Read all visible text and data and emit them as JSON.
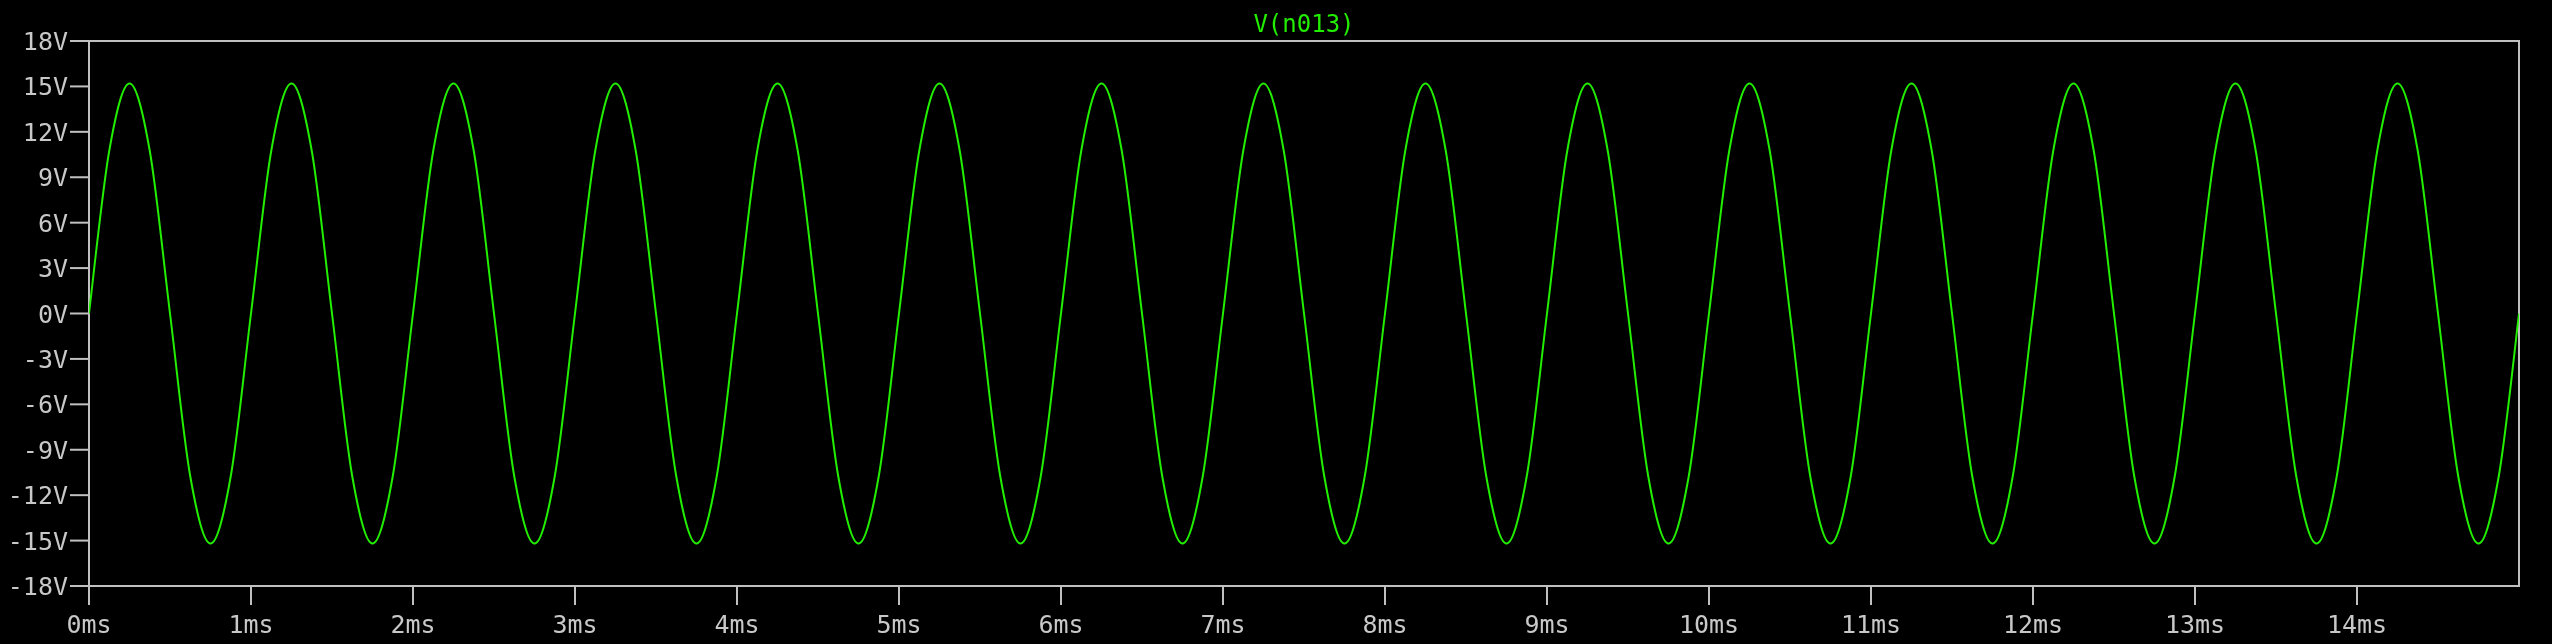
{
  "plot": {
    "chart_data": {
      "type": "line",
      "x": [
        0,
        0.125,
        0.25,
        0.375,
        0.5,
        0.625,
        0.75,
        0.875,
        1,
        1.125,
        1.25,
        1.375,
        1.5,
        1.625,
        1.75,
        1.875,
        2,
        2.125,
        2.25,
        2.375,
        2.5,
        2.625,
        2.75,
        2.875,
        3,
        3.125,
        3.25,
        3.375,
        3.5,
        3.625,
        3.75,
        3.875,
        4,
        4.125,
        4.25,
        4.375,
        4.5,
        4.625,
        4.75,
        4.875,
        5,
        5.125,
        5.25,
        5.375,
        5.5,
        5.625,
        5.75,
        5.875,
        6,
        6.125,
        6.25,
        6.375,
        6.5,
        6.625,
        6.75,
        6.875,
        7,
        7.125,
        7.25,
        7.375,
        7.5,
        7.625,
        7.75,
        7.875,
        8,
        8.125,
        8.25,
        8.375,
        8.5,
        8.625,
        8.75,
        8.875,
        9,
        9.125,
        9.25,
        9.375,
        9.5,
        9.625,
        9.75,
        9.875,
        10,
        10.125,
        10.25,
        10.375,
        10.5,
        10.625,
        10.75,
        10.875,
        11,
        11.125,
        11.25,
        11.375,
        11.5,
        11.625,
        11.75,
        11.875,
        12,
        12.125,
        12.25,
        12.375,
        12.5,
        12.625,
        12.75,
        12.875,
        13,
        13.125,
        13.25,
        13.375,
        13.5,
        13.625,
        13.75,
        13.875,
        14,
        14.125,
        14.25,
        14.375,
        14.5,
        14.625,
        14.75,
        14.875,
        15
      ],
      "series": [
        {
          "name": "V(n013)",
          "color": "#22ee00",
          "values": [
            0,
            10.75,
            15.2,
            10.75,
            0,
            -10.75,
            -15.2,
            -10.75,
            0,
            10.75,
            15.2,
            10.75,
            0,
            -10.75,
            -15.2,
            -10.75,
            0,
            10.75,
            15.2,
            10.75,
            0,
            -10.75,
            -15.2,
            -10.75,
            0,
            10.75,
            15.2,
            10.75,
            0,
            -10.75,
            -15.2,
            -10.75,
            0,
            10.75,
            15.2,
            10.75,
            0,
            -10.75,
            -15.2,
            -10.75,
            0,
            10.75,
            15.2,
            10.75,
            0,
            -10.75,
            -15.2,
            -10.75,
            0,
            10.75,
            15.2,
            10.75,
            0,
            -10.75,
            -15.2,
            -10.75,
            0,
            10.75,
            15.2,
            10.75,
            0,
            -10.75,
            -15.2,
            -10.75,
            0,
            10.75,
            15.2,
            10.75,
            0,
            -10.75,
            -15.2,
            -10.75,
            0,
            10.75,
            15.2,
            10.75,
            0,
            -10.75,
            -15.2,
            -10.75,
            0,
            10.75,
            15.2,
            10.75,
            0,
            -10.75,
            -15.2,
            -10.75,
            0,
            10.75,
            15.2,
            10.75,
            0,
            -10.75,
            -15.2,
            -10.75,
            0,
            10.75,
            15.2,
            10.75,
            0,
            -10.75,
            -15.2,
            -10.75,
            0,
            10.75,
            15.2,
            10.75,
            0,
            -10.75,
            -15.2,
            -10.75,
            0,
            10.75,
            15.2,
            10.75,
            0,
            -10.75,
            -15.2,
            -10.75,
            0
          ]
        }
      ],
      "xlim": [
        0,
        15
      ],
      "ylim": [
        -18,
        18
      ],
      "xticks": [
        {
          "value": 0,
          "label": "0ms"
        },
        {
          "value": 1,
          "label": "1ms"
        },
        {
          "value": 2,
          "label": "2ms"
        },
        {
          "value": 3,
          "label": "3ms"
        },
        {
          "value": 4,
          "label": "4ms"
        },
        {
          "value": 5,
          "label": "5ms"
        },
        {
          "value": 6,
          "label": "6ms"
        },
        {
          "value": 7,
          "label": "7ms"
        },
        {
          "value": 8,
          "label": "8ms"
        },
        {
          "value": 9,
          "label": "9ms"
        },
        {
          "value": 10,
          "label": "10ms"
        },
        {
          "value": 11,
          "label": "11ms"
        },
        {
          "value": 12,
          "label": "12ms"
        },
        {
          "value": 13,
          "label": "13ms"
        },
        {
          "value": 14,
          "label": "14ms"
        }
      ],
      "yticks": [
        {
          "value": 18,
          "label": "18V"
        },
        {
          "value": 15,
          "label": "15V"
        },
        {
          "value": 12,
          "label": "12V"
        },
        {
          "value": 9,
          "label": "9V"
        },
        {
          "value": 6,
          "label": "6V"
        },
        {
          "value": 3,
          "label": "3V"
        },
        {
          "value": 0,
          "label": "0V"
        },
        {
          "value": -3,
          "label": "-3V"
        },
        {
          "value": -6,
          "label": "-6V"
        },
        {
          "value": -9,
          "label": "-9V"
        },
        {
          "value": -12,
          "label": "-12V"
        },
        {
          "value": -15,
          "label": "-15V"
        },
        {
          "value": -18,
          "label": "-18V"
        }
      ]
    }
  }
}
